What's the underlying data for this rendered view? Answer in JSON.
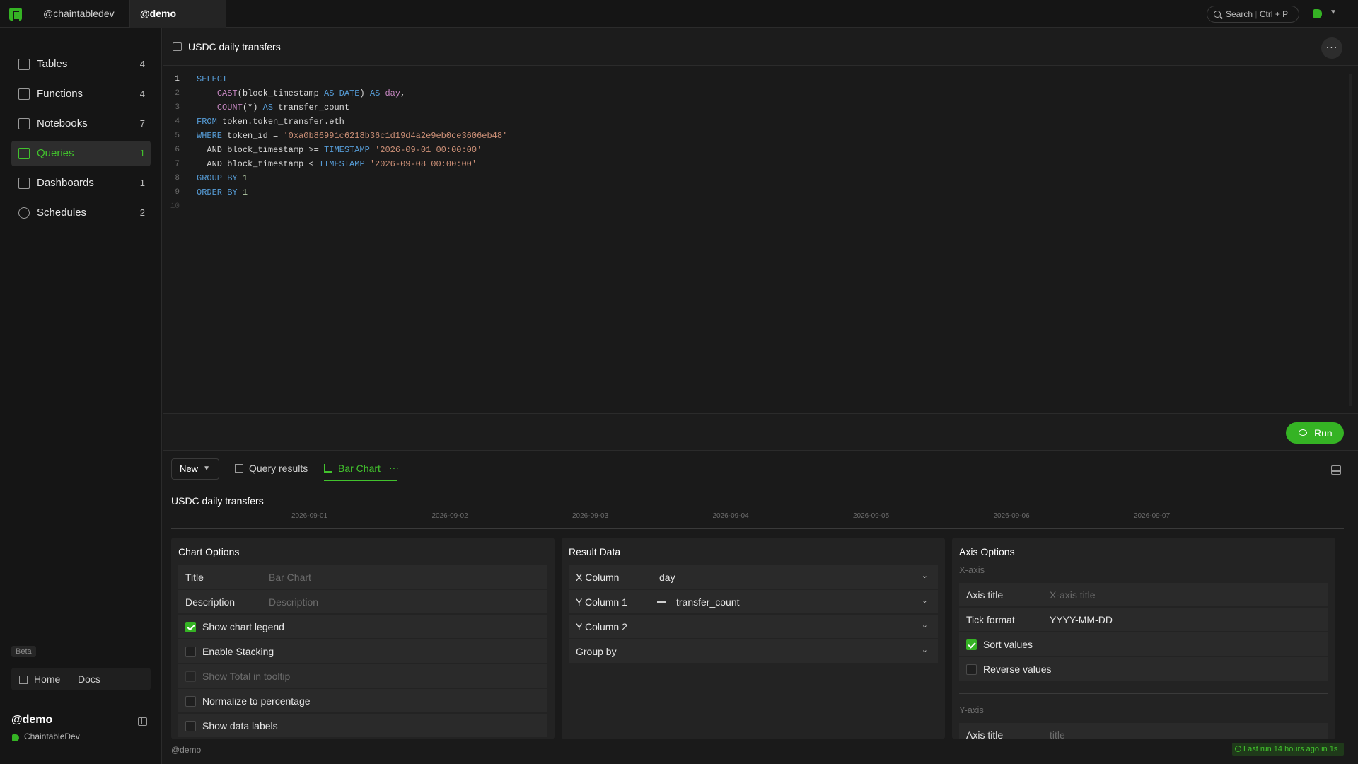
{
  "topbar": {
    "tabs": [
      "@chaintabledev",
      "@demo"
    ],
    "search": {
      "label": "Search",
      "shortcut_key": "Ctrl",
      "shortcut_combo": "+ P"
    }
  },
  "sidebar": {
    "items": [
      {
        "label": "Tables",
        "count": "4",
        "icon": "table-icon"
      },
      {
        "label": "Functions",
        "count": "4",
        "icon": "function-icon"
      },
      {
        "label": "Notebooks",
        "count": "7",
        "icon": "notebook-icon"
      },
      {
        "label": "Queries",
        "count": "1",
        "icon": "query-icon"
      },
      {
        "label": "Dashboards",
        "count": "1",
        "icon": "dashboard-icon"
      },
      {
        "label": "Schedules",
        "count": "2",
        "icon": "clock-icon"
      }
    ],
    "beta": "Beta",
    "footer": {
      "home": "Home",
      "docs": "Docs"
    },
    "workspace": {
      "name": "@demo",
      "org": "ChaintableDev"
    }
  },
  "query": {
    "title": "USDC daily transfers",
    "more": "···"
  },
  "editor": {
    "line_numbers": [
      "1",
      "2",
      "3",
      "4",
      "5",
      "6",
      "7",
      "8",
      "9",
      "10"
    ],
    "tokens": {
      "select": "SELECT",
      "cast": "CAST",
      "cast_arg": "(block_timestamp ",
      "as": "AS",
      "date": "DATE",
      "cast_close": ") ",
      "day": "day",
      "comma": ",",
      "count": "COUNT",
      "count_arg": "(*) ",
      "alias": " transfer_count",
      "from": "FROM",
      "table": " token.token_transfer.eth",
      "where": "WHERE",
      "cond1": " token_id = ",
      "addr": "'0xa0b86991c6218b36c1d19d4a2e9eb0ce3606eb48'",
      "and": "AND",
      "cond2": " block_timestamp >= ",
      "timestamp": "TIMESTAMP",
      "ts1": "'2026-09-01 00:00:00'",
      "cond3": " block_timestamp < ",
      "ts2": "'2026-09-08 00:00:00'",
      "group_by": "GROUP BY",
      "order_by": "ORDER BY",
      "one": "1"
    }
  },
  "run": {
    "label": "Run"
  },
  "results": {
    "new_label": "New",
    "tab_results": "Query results",
    "tab_chart": "Bar Chart",
    "tab_dots": "···"
  },
  "chart_data": {
    "type": "bar",
    "title": "USDC daily transfers",
    "categories": [
      "2026-09-01",
      "2026-09-02",
      "2026-09-03",
      "2026-09-04",
      "2026-09-05",
      "2026-09-06",
      "2026-09-07"
    ],
    "xlabel": "",
    "ylabel": ""
  },
  "chart_options": {
    "heading": "Chart Options",
    "title_label": "Title",
    "title_placeholder": "Bar Chart",
    "desc_label": "Description",
    "desc_placeholder": "Description",
    "checks": [
      {
        "label": "Show chart legend",
        "checked": true,
        "disabled": false
      },
      {
        "label": "Enable Stacking",
        "checked": false,
        "disabled": false
      },
      {
        "label": "Show Total in tooltip",
        "checked": false,
        "disabled": true
      },
      {
        "label": "Normalize to percentage",
        "checked": false,
        "disabled": false
      },
      {
        "label": "Show data labels",
        "checked": false,
        "disabled": false
      }
    ]
  },
  "result_data": {
    "heading": "Result Data",
    "x_label": "X Column",
    "x_value": "day",
    "y1_label": "Y Column 1",
    "y1_value": "transfer_count",
    "y2_label": "Y Column 2",
    "group_label": "Group by"
  },
  "axis_options": {
    "heading": "Axis Options",
    "x_section": "X-axis",
    "axis_title_label": "Axis title",
    "x_axis_title_placeholder": "X-axis title",
    "tick_format_label": "Tick format",
    "tick_format_value": "YYYY-MM-DD",
    "sort_label": "Sort values",
    "sort_checked": true,
    "reverse_label": "Reverse values",
    "reverse_checked": false,
    "y_section": "Y-axis",
    "y_axis_title_label": "Axis title",
    "y_axis_title_placeholder": "title"
  },
  "status": {
    "left": "@demo",
    "right": "Last run 14 hours ago in 1s"
  },
  "colors": {
    "accent": "#35b324",
    "accent_text": "#42c22d",
    "background": "#1a1a1a"
  }
}
